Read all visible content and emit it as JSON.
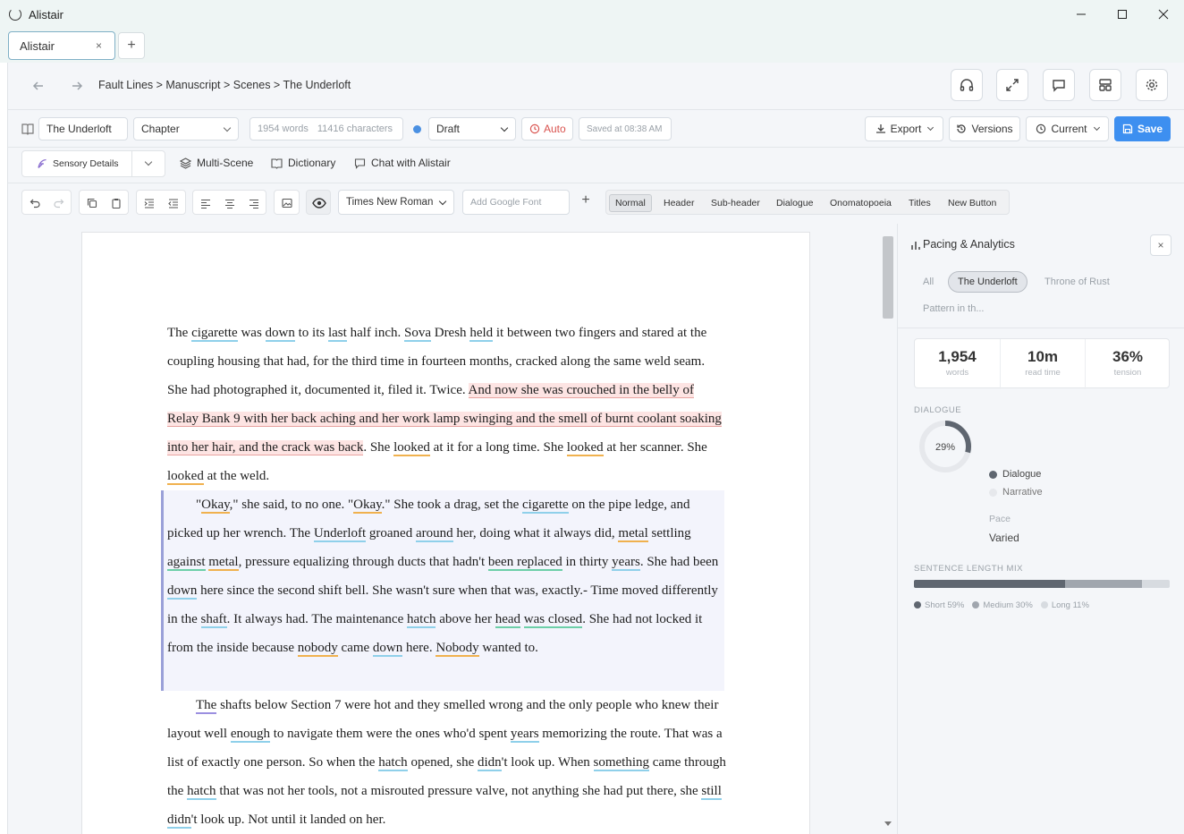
{
  "window": {
    "title": "Alistair",
    "tab_label": "Alistair",
    "tab_close": "×",
    "new_tab": "+"
  },
  "nav": {
    "breadcrumb": "Fault Lines > Manuscript > Scenes > The Underloft",
    "icons": [
      "arrow-left-icon",
      "arrow-right-icon",
      "headphones-icon",
      "expand-icon",
      "comment-icon",
      "layout-icon",
      "gear-icon"
    ]
  },
  "toolbar": {
    "scene_name": "The Underloft",
    "scene_type": "Chapter",
    "word_count": "1954 words",
    "char_count": "11416 characters",
    "status": "Draft",
    "status_dot_color": "#4a90e2",
    "auto_label": "Auto",
    "saved_text": "Saved at 08:38 AM",
    "export_label": "Export",
    "versions_label": "Versions",
    "current_label": "Current",
    "save_label": "Save"
  },
  "tools": {
    "sensory_label": "Sensory Details",
    "multiscene_label": "Multi-Scene",
    "dictionary_label": "Dictionary",
    "chat_label": "Chat with Alistair"
  },
  "format": {
    "font_name": "Times New Roman",
    "google_font_placeholder": "Add Google Font",
    "add": "+",
    "styles": [
      "Normal",
      "Header",
      "Sub-header",
      "Dialogue",
      "Onomatopoeia",
      "Titles",
      "New Button"
    ],
    "active_style": "Normal"
  },
  "document": {
    "p1": [
      [
        "The ",
        ""
      ],
      [
        "cigarette",
        "b"
      ],
      [
        " was ",
        ""
      ],
      [
        "down",
        "b"
      ],
      [
        " to its ",
        ""
      ],
      [
        "last",
        "b"
      ],
      [
        " half inch. ",
        ""
      ],
      [
        "Sova",
        "b"
      ],
      [
        " Dresh ",
        ""
      ],
      [
        "held",
        "b"
      ],
      [
        " it between two fingers and stared at the coupling housing that had, for the third time in fourteen months, cracked along the same weld seam. She had photographed it, documented it, filed it. Twice. ",
        ""
      ],
      [
        "And now she was crouched in the belly of Relay Bank 9 with her ",
        "r"
      ],
      [
        "back",
        "r"
      ],
      [
        " aching and her work lamp swinging and the smell of burnt coolant soaking into her hair, and the crack was ",
        "r"
      ],
      [
        "back",
        "r"
      ],
      [
        ". She ",
        ""
      ],
      [
        "looked",
        "o"
      ],
      [
        " at it for a long time. She ",
        ""
      ],
      [
        "looked",
        "o"
      ],
      [
        " at her scanner. She ",
        ""
      ],
      [
        "looked",
        "o"
      ],
      [
        " at the weld.",
        ""
      ]
    ],
    "p2": [
      [
        "\"",
        ""
      ],
      [
        "Okay",
        "o"
      ],
      [
        ",\" she said, to no one. \"",
        ""
      ],
      [
        "Okay",
        "o"
      ],
      [
        ".\" She took a drag, set the ",
        ""
      ],
      [
        "cigarette",
        "b"
      ],
      [
        " on the pipe ledge, and picked up her wrench. The ",
        ""
      ],
      [
        "Underloft",
        "b"
      ],
      [
        " groaned ",
        ""
      ],
      [
        "around",
        "b"
      ],
      [
        " her, doing what it always did, ",
        ""
      ],
      [
        "metal",
        "o"
      ],
      [
        " settling ",
        ""
      ],
      [
        "against",
        "g"
      ],
      [
        " ",
        ""
      ],
      [
        "metal",
        "o"
      ],
      [
        ", pressure equalizing through ducts that hadn't ",
        ""
      ],
      [
        "been replaced",
        "g"
      ],
      [
        " in thirty ",
        ""
      ],
      [
        "years",
        "b"
      ],
      [
        ". She had been ",
        ""
      ],
      [
        "down",
        "b"
      ],
      [
        " here since the second shift bell. She wasn't sure when that was, exactly.- Time moved differently in the ",
        ""
      ],
      [
        "shaft",
        "b"
      ],
      [
        ". It always had. The maintenance ",
        ""
      ],
      [
        "hatch",
        "b"
      ],
      [
        " above her ",
        ""
      ],
      [
        "head",
        "g"
      ],
      [
        " ",
        ""
      ],
      [
        "was closed",
        "g"
      ],
      [
        ". She had not locked it from the inside because ",
        ""
      ],
      [
        "nobody",
        "o"
      ],
      [
        " came ",
        ""
      ],
      [
        "down",
        "b"
      ],
      [
        " here. ",
        ""
      ],
      [
        "Nobody",
        "o"
      ],
      [
        " wanted to.",
        ""
      ]
    ],
    "p3": [
      [
        "The",
        "p"
      ],
      [
        " shafts below Section 7 were hot and they smelled wrong and the only people who knew their layout well ",
        ""
      ],
      [
        "enough",
        "b"
      ],
      [
        " to navigate them were the ones who'd spent ",
        ""
      ],
      [
        "years",
        "b"
      ],
      [
        " memorizing the route. That was a list of exactly one person. So when the ",
        ""
      ],
      [
        "hatch",
        "b"
      ],
      [
        " opened, she ",
        ""
      ],
      [
        "didn",
        "b"
      ],
      [
        "'t look up. When ",
        ""
      ],
      [
        "something",
        "b"
      ],
      [
        " came through the ",
        ""
      ],
      [
        "hatch",
        "b"
      ],
      [
        " that was not her tools, not a misrouted pressure valve, not anything she had put there, she ",
        ""
      ],
      [
        "still",
        "b"
      ],
      [
        " ",
        ""
      ],
      [
        "didn",
        "b"
      ],
      [
        "'t look up. Not until it landed on her.",
        ""
      ]
    ]
  },
  "panel": {
    "title": "Pacing & Analytics",
    "close": "×",
    "chips": [
      "All",
      "The Underloft",
      "Throne of Rust",
      "Pattern in th..."
    ],
    "active_chip": "The Underloft",
    "stats": [
      {
        "value": "1,954",
        "label": "words"
      },
      {
        "value": "10m",
        "label": "read time"
      },
      {
        "value": "36%",
        "label": "tension"
      }
    ],
    "dialogue_label": "DIALOGUE",
    "dialogue_pct": "29%",
    "dialogue_fraction": 0.29,
    "legend_dialogue": "Dialogue",
    "legend_narrative": "Narrative",
    "pace_label": "Pace",
    "pace_value": "Varied",
    "sentence_label": "SENTENCE LENGTH MIX",
    "mix": [
      {
        "label": "Short 59%",
        "fraction": 0.59,
        "color": "#5f6670"
      },
      {
        "label": "Medium 30%",
        "fraction": 0.3,
        "color": "#a0a6ae"
      },
      {
        "label": "Long 11%",
        "fraction": 0.11,
        "color": "#d7dbe0"
      }
    ]
  }
}
